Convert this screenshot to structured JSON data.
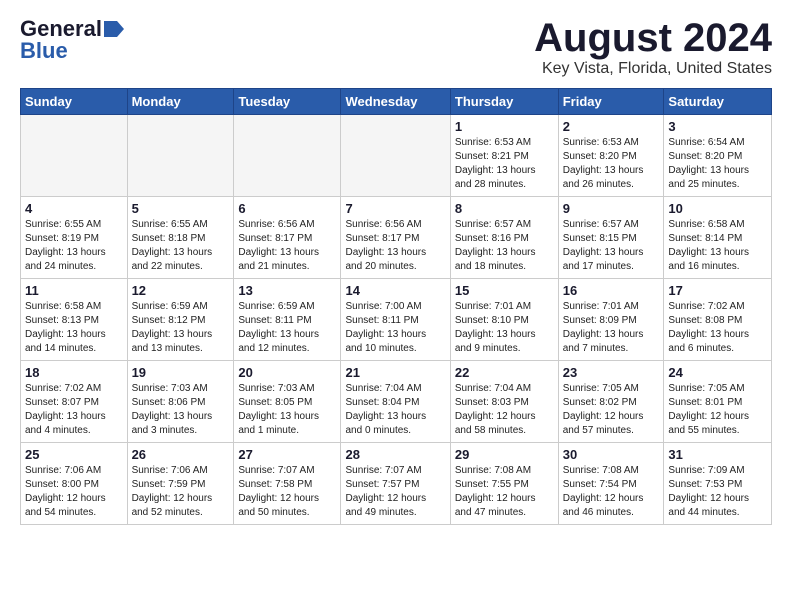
{
  "header": {
    "logo_line1": "General",
    "logo_line2": "Blue",
    "title": "August 2024",
    "subtitle": "Key Vista, Florida, United States"
  },
  "days_of_week": [
    "Sunday",
    "Monday",
    "Tuesday",
    "Wednesday",
    "Thursday",
    "Friday",
    "Saturday"
  ],
  "weeks": [
    [
      {
        "day": "",
        "info": ""
      },
      {
        "day": "",
        "info": ""
      },
      {
        "day": "",
        "info": ""
      },
      {
        "day": "",
        "info": ""
      },
      {
        "day": "1",
        "info": "Sunrise: 6:53 AM\nSunset: 8:21 PM\nDaylight: 13 hours\nand 28 minutes."
      },
      {
        "day": "2",
        "info": "Sunrise: 6:53 AM\nSunset: 8:20 PM\nDaylight: 13 hours\nand 26 minutes."
      },
      {
        "day": "3",
        "info": "Sunrise: 6:54 AM\nSunset: 8:20 PM\nDaylight: 13 hours\nand 25 minutes."
      }
    ],
    [
      {
        "day": "4",
        "info": "Sunrise: 6:55 AM\nSunset: 8:19 PM\nDaylight: 13 hours\nand 24 minutes."
      },
      {
        "day": "5",
        "info": "Sunrise: 6:55 AM\nSunset: 8:18 PM\nDaylight: 13 hours\nand 22 minutes."
      },
      {
        "day": "6",
        "info": "Sunrise: 6:56 AM\nSunset: 8:17 PM\nDaylight: 13 hours\nand 21 minutes."
      },
      {
        "day": "7",
        "info": "Sunrise: 6:56 AM\nSunset: 8:17 PM\nDaylight: 13 hours\nand 20 minutes."
      },
      {
        "day": "8",
        "info": "Sunrise: 6:57 AM\nSunset: 8:16 PM\nDaylight: 13 hours\nand 18 minutes."
      },
      {
        "day": "9",
        "info": "Sunrise: 6:57 AM\nSunset: 8:15 PM\nDaylight: 13 hours\nand 17 minutes."
      },
      {
        "day": "10",
        "info": "Sunrise: 6:58 AM\nSunset: 8:14 PM\nDaylight: 13 hours\nand 16 minutes."
      }
    ],
    [
      {
        "day": "11",
        "info": "Sunrise: 6:58 AM\nSunset: 8:13 PM\nDaylight: 13 hours\nand 14 minutes."
      },
      {
        "day": "12",
        "info": "Sunrise: 6:59 AM\nSunset: 8:12 PM\nDaylight: 13 hours\nand 13 minutes."
      },
      {
        "day": "13",
        "info": "Sunrise: 6:59 AM\nSunset: 8:11 PM\nDaylight: 13 hours\nand 12 minutes."
      },
      {
        "day": "14",
        "info": "Sunrise: 7:00 AM\nSunset: 8:11 PM\nDaylight: 13 hours\nand 10 minutes."
      },
      {
        "day": "15",
        "info": "Sunrise: 7:01 AM\nSunset: 8:10 PM\nDaylight: 13 hours\nand 9 minutes."
      },
      {
        "day": "16",
        "info": "Sunrise: 7:01 AM\nSunset: 8:09 PM\nDaylight: 13 hours\nand 7 minutes."
      },
      {
        "day": "17",
        "info": "Sunrise: 7:02 AM\nSunset: 8:08 PM\nDaylight: 13 hours\nand 6 minutes."
      }
    ],
    [
      {
        "day": "18",
        "info": "Sunrise: 7:02 AM\nSunset: 8:07 PM\nDaylight: 13 hours\nand 4 minutes."
      },
      {
        "day": "19",
        "info": "Sunrise: 7:03 AM\nSunset: 8:06 PM\nDaylight: 13 hours\nand 3 minutes."
      },
      {
        "day": "20",
        "info": "Sunrise: 7:03 AM\nSunset: 8:05 PM\nDaylight: 13 hours\nand 1 minute."
      },
      {
        "day": "21",
        "info": "Sunrise: 7:04 AM\nSunset: 8:04 PM\nDaylight: 13 hours\nand 0 minutes."
      },
      {
        "day": "22",
        "info": "Sunrise: 7:04 AM\nSunset: 8:03 PM\nDaylight: 12 hours\nand 58 minutes."
      },
      {
        "day": "23",
        "info": "Sunrise: 7:05 AM\nSunset: 8:02 PM\nDaylight: 12 hours\nand 57 minutes."
      },
      {
        "day": "24",
        "info": "Sunrise: 7:05 AM\nSunset: 8:01 PM\nDaylight: 12 hours\nand 55 minutes."
      }
    ],
    [
      {
        "day": "25",
        "info": "Sunrise: 7:06 AM\nSunset: 8:00 PM\nDaylight: 12 hours\nand 54 minutes."
      },
      {
        "day": "26",
        "info": "Sunrise: 7:06 AM\nSunset: 7:59 PM\nDaylight: 12 hours\nand 52 minutes."
      },
      {
        "day": "27",
        "info": "Sunrise: 7:07 AM\nSunset: 7:58 PM\nDaylight: 12 hours\nand 50 minutes."
      },
      {
        "day": "28",
        "info": "Sunrise: 7:07 AM\nSunset: 7:57 PM\nDaylight: 12 hours\nand 49 minutes."
      },
      {
        "day": "29",
        "info": "Sunrise: 7:08 AM\nSunset: 7:55 PM\nDaylight: 12 hours\nand 47 minutes."
      },
      {
        "day": "30",
        "info": "Sunrise: 7:08 AM\nSunset: 7:54 PM\nDaylight: 12 hours\nand 46 minutes."
      },
      {
        "day": "31",
        "info": "Sunrise: 7:09 AM\nSunset: 7:53 PM\nDaylight: 12 hours\nand 44 minutes."
      }
    ]
  ]
}
